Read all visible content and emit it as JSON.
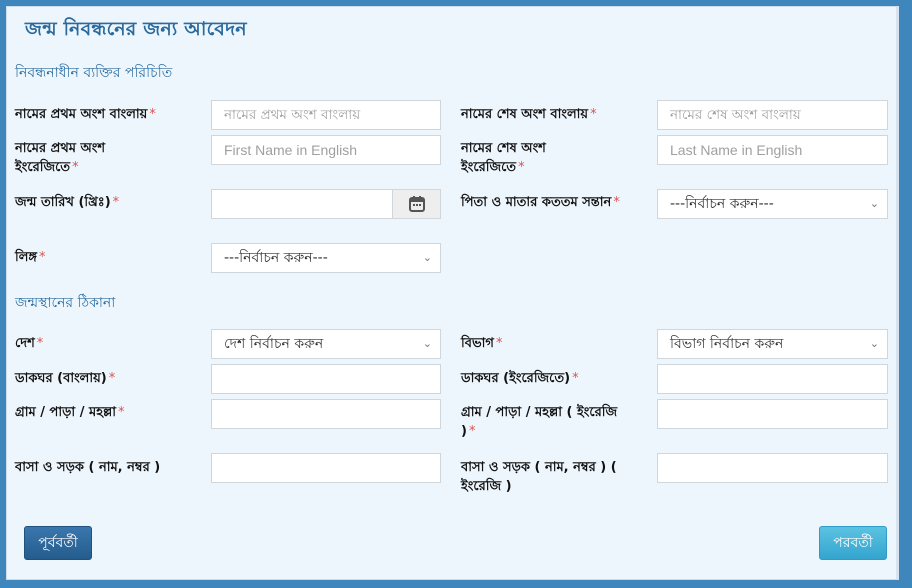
{
  "page": {
    "title": "জন্ম নিবন্ধনের জন্য আবেদন"
  },
  "sections": {
    "identity": "নিবন্ধনাধীন ব্যক্তির পরিচিতি",
    "birthplace": "জন্মস্থানের ঠিকানা"
  },
  "fields": {
    "first_name_bn": {
      "label": "নামের প্রথম অংশ বাংলায়",
      "required": "*",
      "placeholder": "নামের প্রথম অংশ বাংলায়",
      "value": ""
    },
    "last_name_bn": {
      "label": "নামের শেষ অংশ বাংলায়",
      "required": "*",
      "placeholder": "নামের শেষ অংশ বাংলায়",
      "value": ""
    },
    "first_name_en": {
      "label": "নামের প্রথম অংশ ইংরেজিতে",
      "required": "*",
      "placeholder": "First Name in English",
      "value": ""
    },
    "last_name_en": {
      "label": "নামের শেষ অংশ ইংরেজিতে",
      "required": "*",
      "placeholder": "Last Name in English",
      "value": ""
    },
    "dob": {
      "label": "জন্ম তারিখ (খ্রিঃ)",
      "required": "*",
      "value": "",
      "icon": "calendar-icon"
    },
    "birth_order": {
      "label": "পিতা ও মাতার কততম সন্তান",
      "required": "*",
      "selected": "---নির্বাচন করুন---"
    },
    "gender": {
      "label": "লিঙ্গ",
      "required": "*",
      "selected": "---নির্বাচন করুন---"
    },
    "country": {
      "label": "দেশ",
      "required": "*",
      "selected": "দেশ নির্বাচন করুন"
    },
    "division": {
      "label": "বিভাগ",
      "required": "*",
      "selected": "বিভাগ নির্বাচন করুন"
    },
    "post_office_bn": {
      "label": "ডাকঘর (বাংলায়)",
      "required": "*",
      "value": ""
    },
    "post_office_en": {
      "label": "ডাকঘর (ইংরেজিতে)",
      "required": "*",
      "value": ""
    },
    "village_bn": {
      "label": "গ্রাম / পাড়া / মহল্লা",
      "required": "*",
      "value": ""
    },
    "village_en": {
      "label": "গ্রাম / পাড়া / মহল্লা ( ইংরেজি )",
      "required": "*",
      "value": ""
    },
    "house_road_bn": {
      "label": "বাসা ও সড়ক ( নাম, নম্বর )",
      "value": ""
    },
    "house_road_en": {
      "label": "বাসা ও সড়ক ( নাম, নম্বর ) ( ইংরেজি )",
      "value": ""
    }
  },
  "buttons": {
    "previous": "পূর্ববর্তী",
    "next": "পরবর্তী"
  },
  "colors": {
    "frame": "#3f86bd",
    "panel": "#eef6fd",
    "heading": "#2b6a9c",
    "required": "#d9534f",
    "prev_button": "#2a659a",
    "next_button": "#44b2d9"
  }
}
